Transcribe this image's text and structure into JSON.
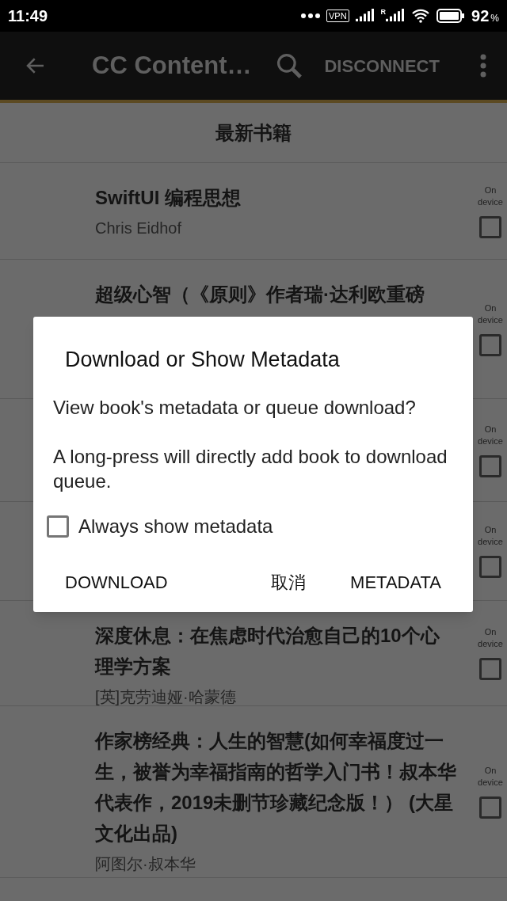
{
  "status_bar": {
    "time": "11:49",
    "vpn": "VPN",
    "roaming": "R",
    "battery": "92",
    "battery_unit": "%"
  },
  "app_bar": {
    "title": "CC Content…",
    "action": "DISCONNECT"
  },
  "section_title": "最新书籍",
  "books": [
    {
      "title": "SwiftUI 编程思想",
      "author": "Chris Eidhof",
      "on_device_label": "On device",
      "on_device": false
    },
    {
      "title": "超级心智（《原则》作者瑞·达利欧重磅",
      "on_device_label": "On device",
      "on_device": false
    },
    {
      "on_device_label": "On device",
      "on_device": false
    },
    {
      "on_device_label": "On device",
      "on_device": false
    },
    {
      "title": "深度休息：在焦虑时代治愈自己的10个心理学方案",
      "author": "[英]克劳迪娅·哈蒙德",
      "on_device_label": "On device",
      "on_device": false
    },
    {
      "title": "作家榜经典：人生的智慧(如何幸福度过一生，被誉为幸福指南的哲学入门书！叔本华代表作，2019未删节珍藏纪念版！） (大星文化出品)",
      "author": "阿图尔·叔本华",
      "on_device_label": "On device",
      "on_device": false
    }
  ],
  "dialog": {
    "title": "Download or Show Metadata",
    "message": "View book's metadata or queue download?",
    "note": "A long-press will directly add book to download queue.",
    "checkbox": {
      "label": "Always show metadata",
      "checked": false
    },
    "buttons": [
      "DOWNLOAD",
      "取消",
      "METADATA"
    ]
  }
}
